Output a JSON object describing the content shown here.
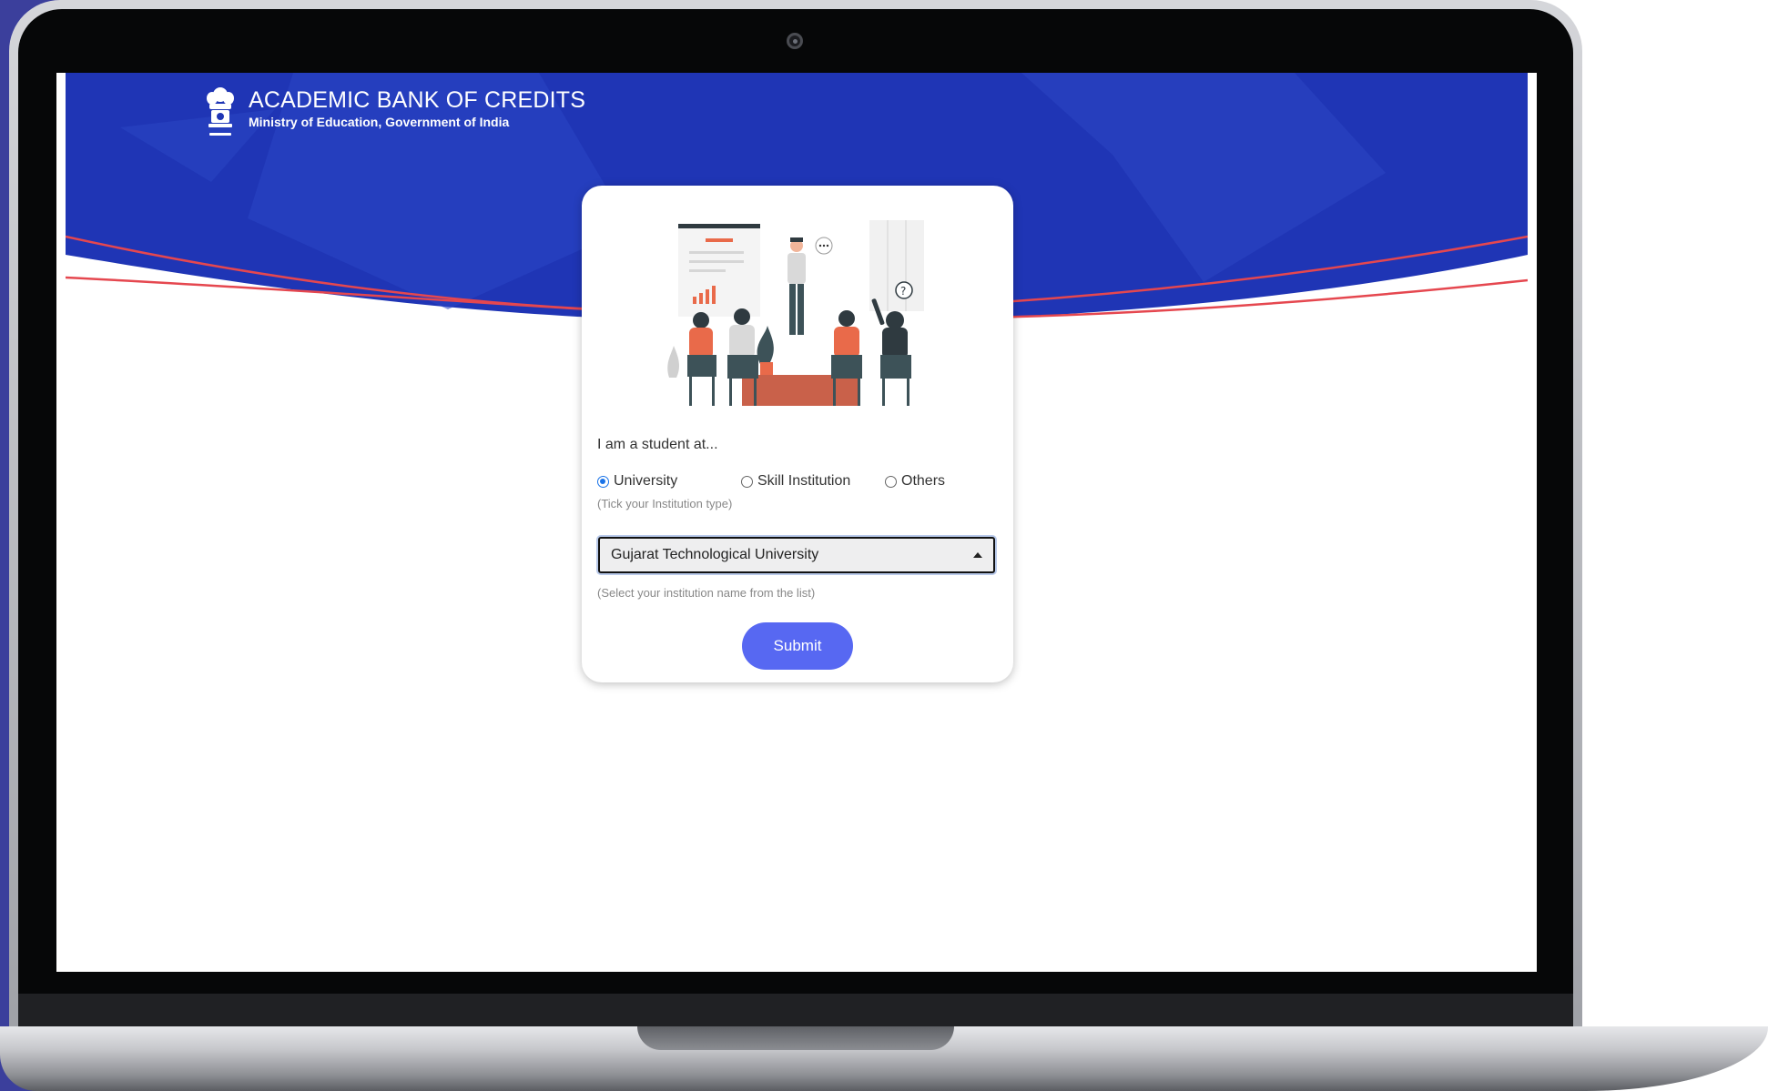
{
  "header": {
    "title": "ACADEMIC BANK OF CREDITS",
    "subtitle": "Ministry of Education, Government of India",
    "emblem_icon": "national-emblem-icon"
  },
  "form": {
    "prompt": "I am a student at...",
    "institution_types": [
      {
        "label": "University",
        "selected": true
      },
      {
        "label": "Skill Institution",
        "selected": false
      },
      {
        "label": "Others",
        "selected": false
      }
    ],
    "type_hint": "(Tick your Institution type)",
    "institution_select": {
      "value": "Gujarat Technological University",
      "icon": "caret-up-icon"
    },
    "select_hint": "(Select your institution name from the list)",
    "submit_label": "Submit"
  },
  "colors": {
    "hero_blue": "#1f35b5",
    "accent_red": "#e5474f",
    "button": "#5768f2"
  }
}
